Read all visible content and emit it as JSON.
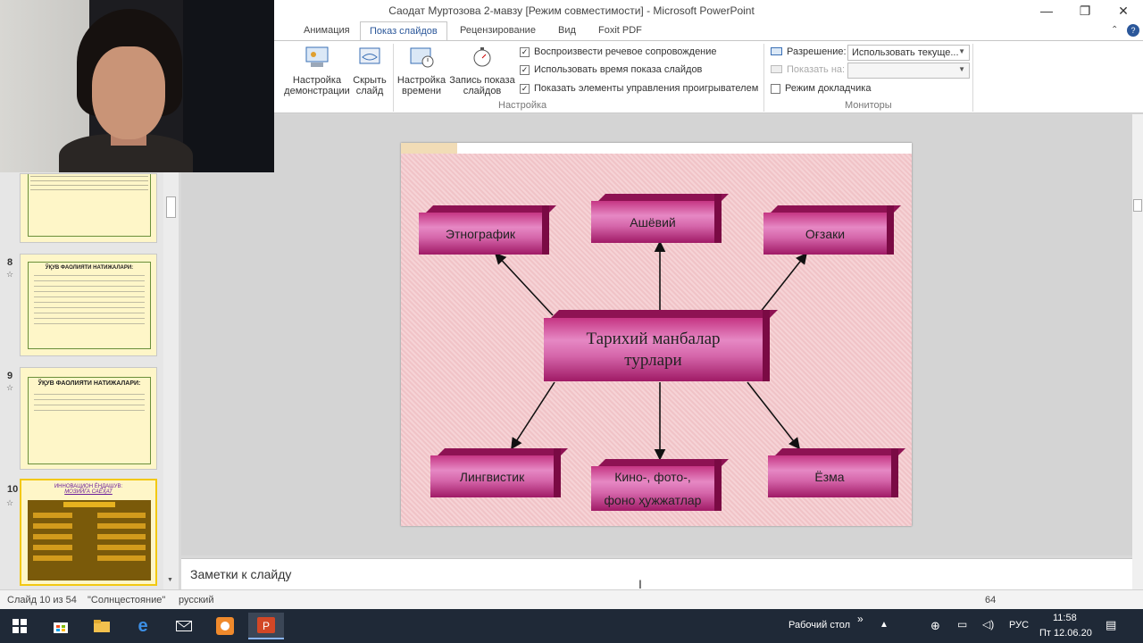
{
  "window": {
    "title": "Саодат Муртозова 2-мавзу [Режим совместимости]  -  Microsoft PowerPoint"
  },
  "tabs": [
    "Анимация",
    "Показ слайдов",
    "Рецензирование",
    "Вид",
    "Foxit PDF"
  ],
  "active_tab": "Показ слайдов",
  "ribbon": {
    "buttons": {
      "setup": "Настройка\nдемонстрации",
      "hide": "Скрыть\nслайд",
      "timing": "Настройка\nвремени",
      "record": "Запись показа\nслайдов"
    },
    "checkboxes": [
      {
        "label": "Воспроизвести речевое сопровождение",
        "checked": true
      },
      {
        "label": "Использовать время показа слайдов",
        "checked": true
      },
      {
        "label": "Показать элементы управления проигрывателем",
        "checked": true
      }
    ],
    "group_setup": "Настройка",
    "resolution_label": "Разрешение:",
    "resolution_value": "Использовать текуще...",
    "show_on_label": "Показать на:",
    "presenter_view": "Режим докладчика",
    "group_monitors": "Мониторы"
  },
  "thumbnails": [
    {
      "num": "8",
      "title": "ЎҚУВ ФАОЛИЯТИ НАТИЖАЛАРИ:"
    },
    {
      "num": "9",
      "title": "ЎҚУВ ФАОЛИЯТИ НАТИЖАЛАРИ:"
    },
    {
      "num": "10",
      "title": "ИННОВАЦИОН ЁНДАШУВ:",
      "subtitle": "МОЗИЙГА САЁҲАТ"
    }
  ],
  "slide": {
    "center": "Тарихий манбалар\nтурлари",
    "nodes": [
      "Этнографик",
      "Ашёвий",
      "Оғзаки",
      "Лингвистик",
      "Кино-, фото-,\nфоно   ҳужжатлар",
      "Ёзма"
    ]
  },
  "notes_placeholder": "Заметки к слайду",
  "status": {
    "slide_info": "Слайд 10 из 54",
    "theme": "\"Солнцестояние\"",
    "language": "русский",
    "zoom": "64"
  },
  "taskbar": {
    "desktop": "Рабочий стол",
    "lang": "РУС",
    "time": "11:58",
    "date": "Пт 12.06.20"
  },
  "colors": {
    "accent": "#2b579a",
    "node": "#d566aa"
  }
}
